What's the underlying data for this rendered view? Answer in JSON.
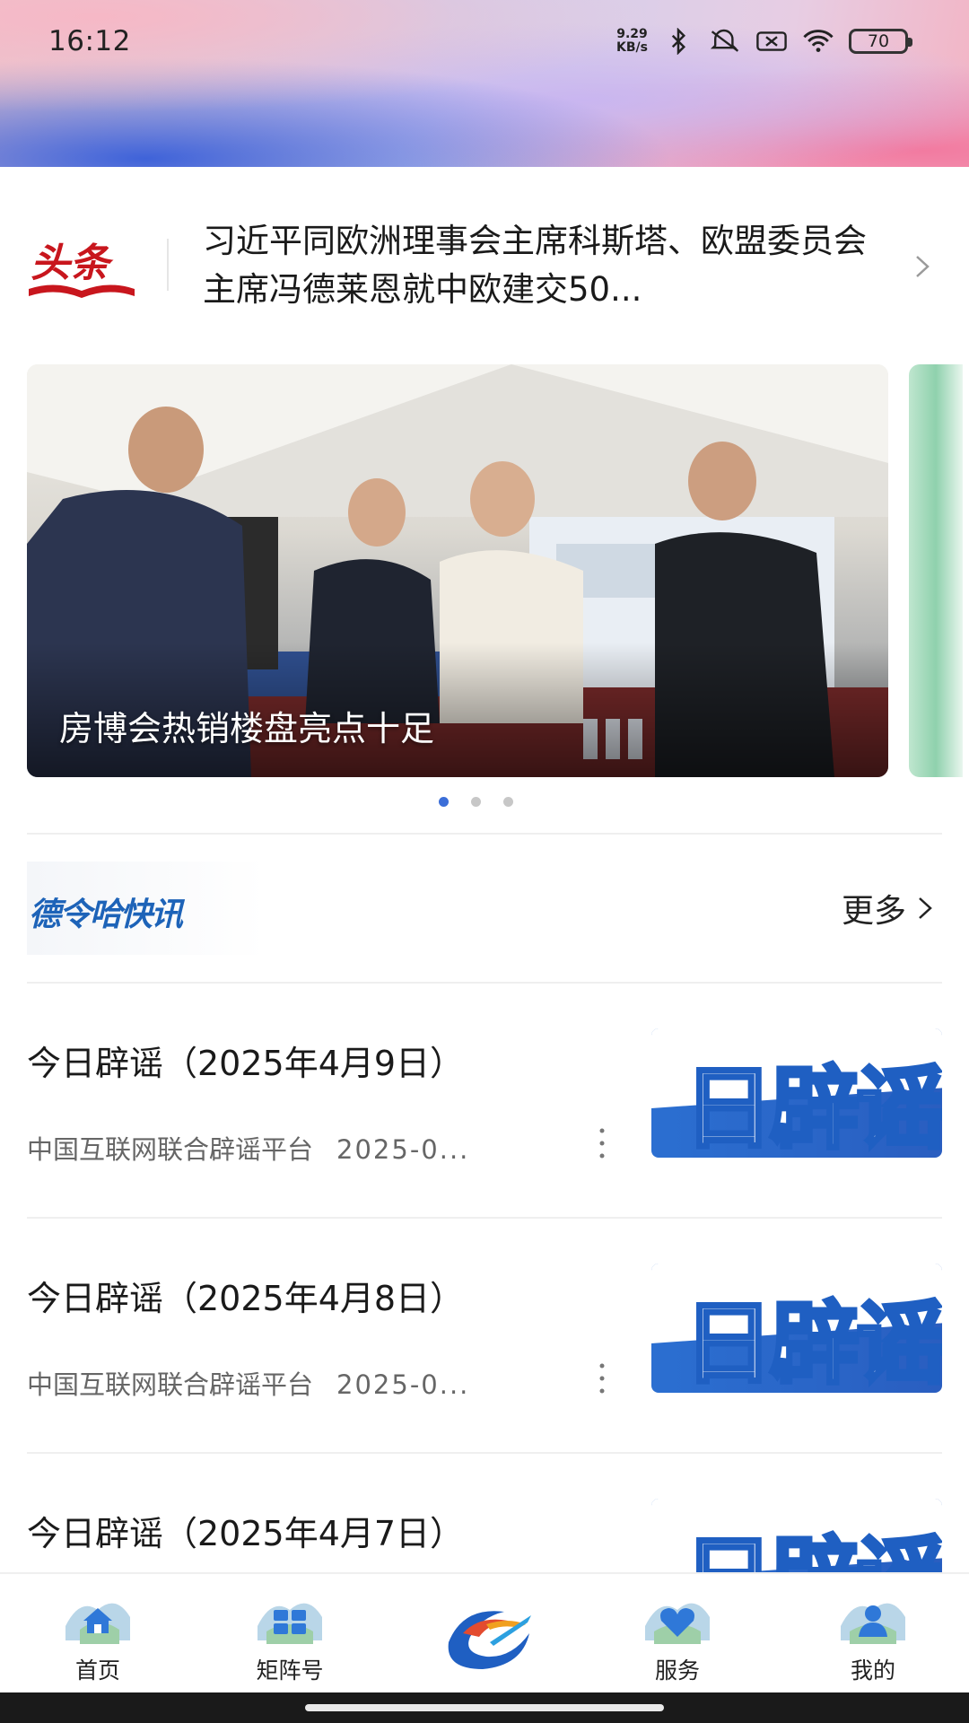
{
  "status_bar": {
    "time": "16:12",
    "speed_value": "9.29",
    "speed_unit": "KB/s",
    "battery": "70"
  },
  "headline": {
    "logo_text": "头条",
    "text": "习近平同欧洲理事会主席科斯塔、欧盟委员会主席冯德莱恩就中欧建交50..."
  },
  "carousel": {
    "caption": "房博会热销楼盘亮点十足",
    "page_count": 3,
    "active_index": 0
  },
  "section": {
    "logo_text": "德令哈快讯",
    "more_label": "更多"
  },
  "news": [
    {
      "title": "今日辟谣（2025年4月9日）",
      "source": "中国互联网联合辟谣平台",
      "date": "2025-0...",
      "thumb_text": "日辟谣"
    },
    {
      "title": "今日辟谣（2025年4月8日）",
      "source": "中国互联网联合辟谣平台",
      "date": "2025-0...",
      "thumb_text": "日辟谣"
    },
    {
      "title": "今日辟谣（2025年4月7日）",
      "thumb_text": "日辟谣"
    }
  ],
  "bottom_nav": [
    {
      "label": "首页",
      "icon": "home-icon"
    },
    {
      "label": "矩阵号",
      "icon": "grid-icon"
    },
    {
      "label": "",
      "icon": "app-logo-icon"
    },
    {
      "label": "服务",
      "icon": "heart-icon"
    },
    {
      "label": "我的",
      "icon": "person-icon"
    }
  ],
  "colors": {
    "accent": "#3b6ed8",
    "brand_blue": "#1d63b8",
    "headline_red": "#c8161d"
  }
}
